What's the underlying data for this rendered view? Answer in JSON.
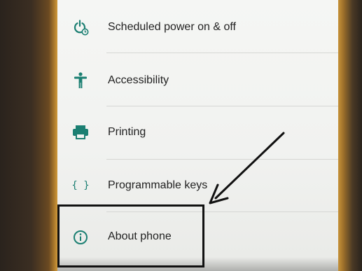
{
  "settings": {
    "items": [
      {
        "label": "Scheduled power on & off",
        "icon": "scheduled-power-icon"
      },
      {
        "label": "Accessibility",
        "icon": "accessibility-icon"
      },
      {
        "label": "Printing",
        "icon": "printer-icon"
      },
      {
        "label": "Programmable keys",
        "icon": "braces-icon",
        "glyph": "{ }"
      },
      {
        "label": "About phone",
        "icon": "info-icon"
      }
    ]
  },
  "colors": {
    "accent": "#1b7f72",
    "annotation": "#111111"
  }
}
